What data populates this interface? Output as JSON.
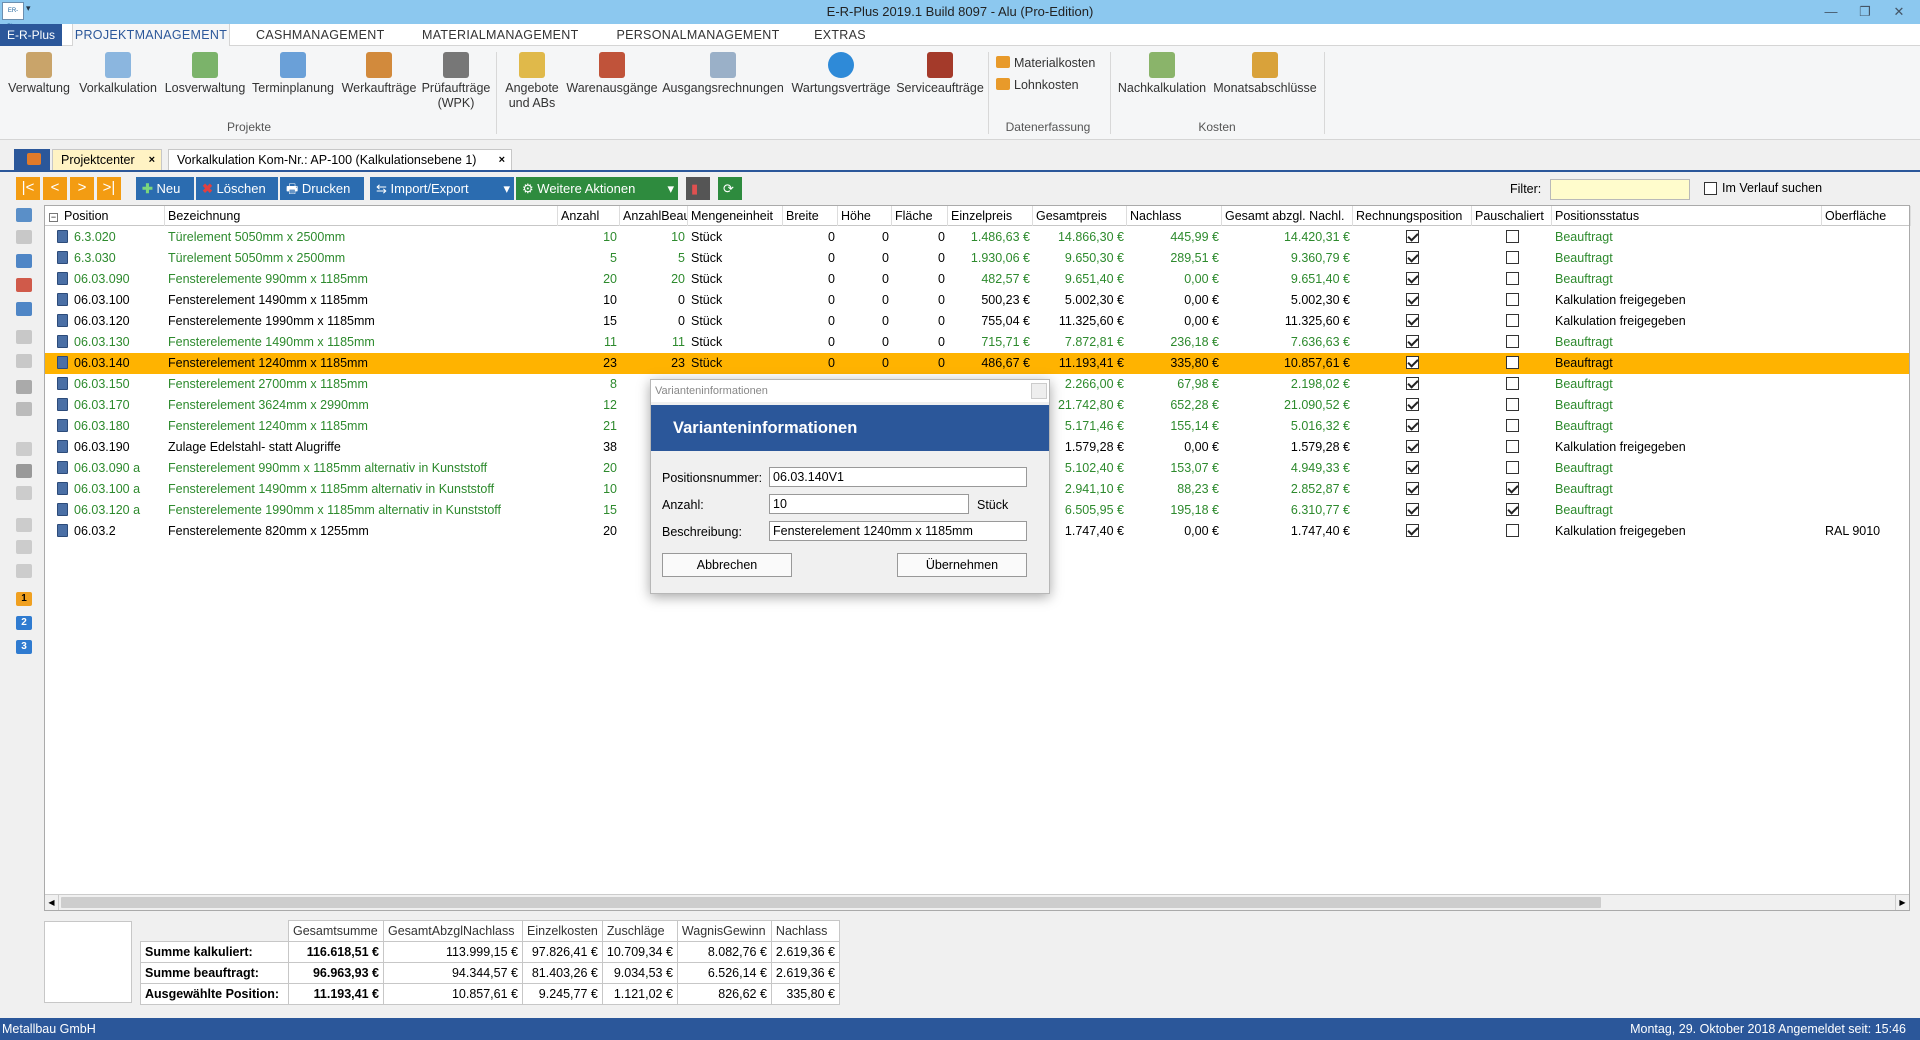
{
  "window": {
    "title": "E-R-Plus 2019.1 Build 8097 -  Alu (Pro-Edition)"
  },
  "menu": {
    "file": "E-R-Plus",
    "tabs": [
      "PROJEKTMANAGEMENT",
      "CASHMANAGEMENT",
      "MATERIALMANAGEMENT",
      "PERSONALMANAGEMENT",
      "EXTRAS"
    ]
  },
  "ribbon": {
    "projekte": [
      "Verwaltung",
      "Vorkalkulation",
      "Losverwaltung",
      "Terminplanung",
      "Werkaufträge",
      "Prüfaufträge\n(WPK)"
    ],
    "projekte_label": "Projekte",
    "angebote": "Angebote\nund ABs",
    "warenausgaenge": "Warenausgänge",
    "ausgangsrechnungen": "Ausgangsrechnungen",
    "wartungsvertraege": "Wartungsverträge",
    "serviceauftraege": "Serviceaufträge",
    "materialkosten": "Materialkosten",
    "lohnkosten": "Lohnkosten",
    "datenerfassung_label": "Datenerfassung",
    "nachkalkulation": "Nachkalkulation",
    "monatsabschluesse": "Monatsabschlüsse",
    "kosten_label": "Kosten"
  },
  "doctabs": [
    "Projektcenter",
    "Vorkalkulation Kom-Nr.: AP-100 (Kalkulationsebene 1)"
  ],
  "toolbar": {
    "neu": "Neu",
    "loeschen": "Löschen",
    "drucken": "Drucken",
    "import_export": "Import/Export",
    "weitere": "Weitere Aktionen",
    "filter_label": "Filter:",
    "filter_value": "",
    "verlauf": "Im Verlauf suchen"
  },
  "columns": [
    "Position",
    "Bezeichnung",
    "Anzahl",
    "AnzahlBeau",
    "Mengeneinheit",
    "Breite",
    "Höhe",
    "Fläche",
    "Einzelpreis",
    "Gesamtpreis",
    "Nachlass",
    "Gesamt abzgl. Nachl.",
    "Rechnungsposition",
    "Pauschaliert",
    "Positionsstatus",
    "Oberfläche"
  ],
  "rows": [
    {
      "pos": "6.3.020",
      "bez": "Türelement 5050mm x 2500mm",
      "anz": "10",
      "anzb": "10",
      "me": "Stück",
      "b": "0",
      "h": "0",
      "f": "0",
      "ep": "1.486,63 €",
      "gp": "14.866,30 €",
      "nl": "445,99 €",
      "gn": "14.420,31 €",
      "rp": true,
      "pa": false,
      "st": "Beauftragt",
      "ob": "",
      "green": true
    },
    {
      "pos": "6.3.030",
      "bez": "Türelement 5050mm x 2500mm",
      "anz": "5",
      "anzb": "5",
      "me": "Stück",
      "b": "0",
      "h": "0",
      "f": "0",
      "ep": "1.930,06 €",
      "gp": "9.650,30 €",
      "nl": "289,51 €",
      "gn": "9.360,79 €",
      "rp": true,
      "pa": false,
      "st": "Beauftragt",
      "ob": "",
      "green": true
    },
    {
      "pos": "06.03.090",
      "bez": "Fensterelemente 990mm x 1185mm",
      "anz": "20",
      "anzb": "20",
      "me": "Stück",
      "b": "0",
      "h": "0",
      "f": "0",
      "ep": "482,57 €",
      "gp": "9.651,40 €",
      "nl": "0,00 €",
      "gn": "9.651,40 €",
      "rp": true,
      "pa": false,
      "st": "Beauftragt",
      "ob": "",
      "green": true
    },
    {
      "pos": "06.03.100",
      "bez": "Fensterelement 1490mm x 1185mm",
      "anz": "10",
      "anzb": "0",
      "me": "Stück",
      "b": "0",
      "h": "0",
      "f": "0",
      "ep": "500,23 €",
      "gp": "5.002,30 €",
      "nl": "0,00 €",
      "gn": "5.002,30 €",
      "rp": true,
      "pa": false,
      "st": "Kalkulation freigegeben",
      "ob": "",
      "green": false
    },
    {
      "pos": "06.03.120",
      "bez": "Fensterelemente 1990mm x 1185mm",
      "anz": "15",
      "anzb": "0",
      "me": "Stück",
      "b": "0",
      "h": "0",
      "f": "0",
      "ep": "755,04 €",
      "gp": "11.325,60 €",
      "nl": "0,00 €",
      "gn": "11.325,60 €",
      "rp": true,
      "pa": false,
      "st": "Kalkulation freigegeben",
      "ob": "",
      "green": false
    },
    {
      "pos": "06.03.130",
      "bez": "Fensterelemente 1490mm x 1185mm",
      "anz": "11",
      "anzb": "11",
      "me": "Stück",
      "b": "0",
      "h": "0",
      "f": "0",
      "ep": "715,71 €",
      "gp": "7.872,81 €",
      "nl": "236,18 €",
      "gn": "7.636,63 €",
      "rp": true,
      "pa": false,
      "st": "Beauftragt",
      "ob": "",
      "green": true
    },
    {
      "pos": "06.03.140",
      "bez": "Fensterelement 1240mm x 1185mm",
      "anz": "23",
      "anzb": "23",
      "me": "Stück",
      "b": "0",
      "h": "0",
      "f": "0",
      "ep": "486,67 €",
      "gp": "11.193,41 €",
      "nl": "335,80 €",
      "gn": "10.857,61 €",
      "rp": true,
      "pa": false,
      "st": "Beauftragt",
      "ob": "",
      "green": false,
      "sel": true
    },
    {
      "pos": "06.03.150",
      "bez": "Fensterelement 2700mm x 1185mm",
      "anz": "8",
      "anzb": "",
      "me": "",
      "b": "",
      "h": "",
      "f": "",
      "ep": "",
      "gp": "2.266,00 €",
      "nl": "67,98 €",
      "gn": "2.198,02 €",
      "rp": true,
      "pa": false,
      "st": "Beauftragt",
      "ob": "",
      "green": true
    },
    {
      "pos": "06.03.170",
      "bez": "Fensterelement 3624mm x 2990mm",
      "anz": "12",
      "anzb": "",
      "me": "",
      "b": "",
      "h": "",
      "f": "",
      "ep": "",
      "gp": "21.742,80 €",
      "nl": "652,28 €",
      "gn": "21.090,52 €",
      "rp": true,
      "pa": false,
      "st": "Beauftragt",
      "ob": "",
      "green": true
    },
    {
      "pos": "06.03.180",
      "bez": "Fensterelement 1240mm x 1185mm",
      "anz": "21",
      "anzb": "",
      "me": "",
      "b": "",
      "h": "",
      "f": "",
      "ep": "",
      "gp": "5.171,46 €",
      "nl": "155,14 €",
      "gn": "5.016,32 €",
      "rp": true,
      "pa": false,
      "st": "Beauftragt",
      "ob": "",
      "green": true
    },
    {
      "pos": "06.03.190",
      "bez": "Zulage Edelstahl- statt Alugriffe",
      "anz": "38",
      "anzb": "",
      "me": "",
      "b": "",
      "h": "",
      "f": "",
      "ep": "",
      "gp": "1.579,28 €",
      "nl": "0,00 €",
      "gn": "1.579,28 €",
      "rp": true,
      "pa": false,
      "st": "Kalkulation freigegeben",
      "ob": "",
      "green": false
    },
    {
      "pos": "06.03.090 a",
      "bez": "Fensterelement 990mm x 1185mm alternativ in Kunststoff",
      "anz": "20",
      "anzb": "",
      "me": "",
      "b": "",
      "h": "",
      "f": "",
      "ep": "",
      "gp": "5.102,40 €",
      "nl": "153,07 €",
      "gn": "4.949,33 €",
      "rp": true,
      "pa": false,
      "st": "Beauftragt",
      "ob": "",
      "green": true
    },
    {
      "pos": "06.03.100 a",
      "bez": "Fensterelement 1490mm x 1185mm alternativ in Kunststoff",
      "anz": "10",
      "anzb": "",
      "me": "",
      "b": "",
      "h": "",
      "f": "",
      "ep": "",
      "gp": "2.941,10 €",
      "nl": "88,23 €",
      "gn": "2.852,87 €",
      "rp": true,
      "pa": true,
      "st": "Beauftragt",
      "ob": "",
      "green": true
    },
    {
      "pos": "06.03.120 a",
      "bez": "Fensterelemente 1990mm x 1185mm alternativ in Kunststoff",
      "anz": "15",
      "anzb": "",
      "me": "",
      "b": "",
      "h": "",
      "f": "",
      "ep": "",
      "gp": "6.505,95 €",
      "nl": "195,18 €",
      "gn": "6.310,77 €",
      "rp": true,
      "pa": true,
      "st": "Beauftragt",
      "ob": "",
      "green": true
    },
    {
      "pos": "06.03.2",
      "bez": "Fensterelemente 820mm x 1255mm",
      "anz": "20",
      "anzb": "",
      "me": "",
      "b": "",
      "h": "",
      "f": "",
      "ep": "",
      "gp": "1.747,40 €",
      "nl": "0,00 €",
      "gn": "1.747,40 €",
      "rp": true,
      "pa": false,
      "st": "Kalkulation freigegeben",
      "ob": "RAL 9010",
      "green": false
    }
  ],
  "summary": {
    "headers": [
      "Gesamtsumme",
      "GesamtAbzglNachlass",
      "Einzelkosten",
      "Zuschläge",
      "WagnisGewinn",
      "Nachlass"
    ],
    "rows": [
      {
        "label": "Summe kalkuliert:",
        "vals": [
          "116.618,51 €",
          "113.999,15 €",
          "97.826,41 €",
          "10.709,34 €",
          "8.082,76 €",
          "2.619,36 €"
        ]
      },
      {
        "label": "Summe beauftragt:",
        "vals": [
          "96.963,93 €",
          "94.344,57 €",
          "81.403,26 €",
          "9.034,53 €",
          "6.526,14 €",
          "2.619,36 €"
        ]
      },
      {
        "label": "Ausgewählte Position:",
        "vals": [
          "11.193,41 €",
          "10.857,61 €",
          "9.245,77 €",
          "1.121,02 €",
          "826,62 €",
          "335,80 €"
        ]
      }
    ]
  },
  "dialog": {
    "window_title": "Varianteninformationen",
    "heading": "Varianteninformationen",
    "pos_label": "Positionsnummer:",
    "pos_value": "06.03.140V1",
    "anz_label": "Anzahl:",
    "anz_value": "10",
    "unit": "Stück",
    "bes_label": "Beschreibung:",
    "bes_value": "Fensterelement 1240mm x 1185mm",
    "cancel": "Abbrechen",
    "ok": "Übernehmen"
  },
  "status": {
    "company": "Metallbau GmbH",
    "datetime": "Montag, 29. Oktober 2018   Angemeldet seit: 15:46"
  },
  "colors": {
    "accent": "#2b579a",
    "selection": "#ffb300",
    "green_text": "#2d8a2d",
    "toolbar_blue": "#2b6cb0",
    "toolbar_green": "#2e8b3e",
    "nav_orange": "#f39c12"
  }
}
